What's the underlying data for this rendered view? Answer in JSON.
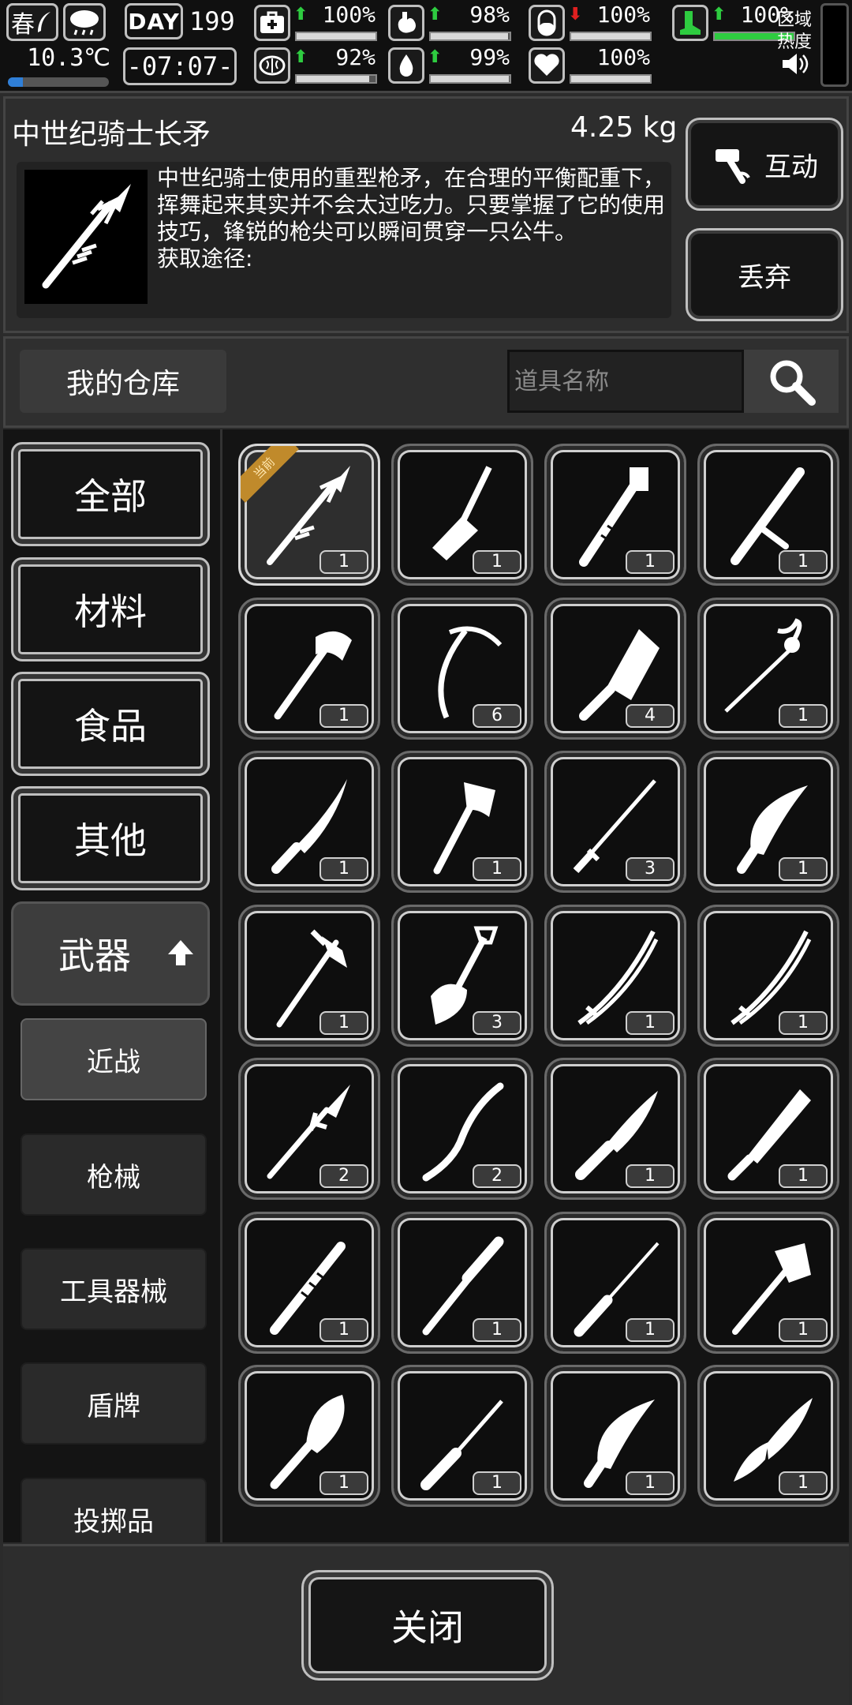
{
  "status": {
    "season": "春",
    "temperature": "10.3℃",
    "temperature_level": 0.15,
    "day_label": "DAY",
    "day": "199",
    "clock": "-07:07-",
    "zone_label_1": "区域",
    "zone_label_2": "热度",
    "stats": [
      {
        "name": "health",
        "icon": "medkit-icon",
        "value": "100%",
        "level": 1.0,
        "trend": "up"
      },
      {
        "name": "hunger",
        "icon": "stomach-icon",
        "value": "98%",
        "level": 0.98,
        "trend": "up"
      },
      {
        "name": "pill",
        "icon": "pill-icon",
        "value": "100%",
        "level": 1.0,
        "trend": "down"
      },
      {
        "name": "stamina",
        "icon": "boot-icon",
        "value": "100%",
        "level": 1.0,
        "trend": "up"
      },
      {
        "name": "mental",
        "icon": "brain-icon",
        "value": "92%",
        "level": 0.92,
        "trend": "up"
      },
      {
        "name": "thirst",
        "icon": "water-drop-icon",
        "value": "99%",
        "level": 0.99,
        "trend": "up"
      },
      {
        "name": "mood",
        "icon": "heart-icon",
        "value": "100%",
        "level": 1.0,
        "trend": "none"
      }
    ]
  },
  "detail": {
    "name": "中世纪骑士长矛",
    "weight": "4.25 kg",
    "description": "中世纪骑士使用的重型枪矛，在合理的平衡配重下，挥舞起来其实并不会太过吃力。只要掌握了它的使用技巧，锋锐的枪尖可以瞬间贯穿一只公牛。",
    "source_label": "获取途径:",
    "interact_label": "互动",
    "drop_label": "丢弃"
  },
  "warehouse": {
    "tab_label": "我的仓库",
    "search_placeholder": "道具名称"
  },
  "categories": {
    "all": "全部",
    "materials": "材料",
    "food": "食品",
    "other": "其他",
    "weapons": "武器",
    "subs": [
      "近战",
      "枪械",
      "工具器械",
      "盾牌",
      "投掷品"
    ]
  },
  "items": [
    {
      "icon": "knight-lance-icon",
      "count": "1",
      "selected": true,
      "tag": "当前"
    },
    {
      "icon": "shovel-blade-icon",
      "count": "1"
    },
    {
      "icon": "pipe-wrench-icon",
      "count": "1"
    },
    {
      "icon": "baton-icon",
      "count": "1"
    },
    {
      "icon": "hatchet-icon",
      "count": "1"
    },
    {
      "icon": "ice-axe-icon",
      "count": "6"
    },
    {
      "icon": "cleaver-icon",
      "count": "4"
    },
    {
      "icon": "rapier-icon",
      "count": "1"
    },
    {
      "icon": "machete-icon",
      "count": "1"
    },
    {
      "icon": "tomahawk-icon",
      "count": "1"
    },
    {
      "icon": "thin-sword-icon",
      "count": "3"
    },
    {
      "icon": "kukri-icon",
      "count": "1"
    },
    {
      "icon": "fire-axe-icon",
      "count": "1"
    },
    {
      "icon": "spade-icon",
      "count": "3"
    },
    {
      "icon": "katana-icon",
      "count": "1"
    },
    {
      "icon": "katana-icon",
      "count": "1"
    },
    {
      "icon": "spear-icon",
      "count": "2"
    },
    {
      "icon": "wooden-club-icon",
      "count": "2"
    },
    {
      "icon": "combat-knife-icon",
      "count": "1"
    },
    {
      "icon": "saw-machete-icon",
      "count": "1"
    },
    {
      "icon": "serrated-knife-icon",
      "count": "1"
    },
    {
      "icon": "baseball-bat-icon",
      "count": "1"
    },
    {
      "icon": "stiletto-icon",
      "count": "1"
    },
    {
      "icon": "axe-icon",
      "count": "1"
    },
    {
      "icon": "trowel-icon",
      "count": "1"
    },
    {
      "icon": "screwdriver-icon",
      "count": "1"
    },
    {
      "icon": "kukri-icon",
      "count": "1"
    },
    {
      "icon": "folding-knife-icon",
      "count": "1"
    }
  ],
  "close_label": "关闭",
  "colors": {
    "up": "#2ecc40",
    "down": "#e02020",
    "tag": "#c08a2b"
  }
}
